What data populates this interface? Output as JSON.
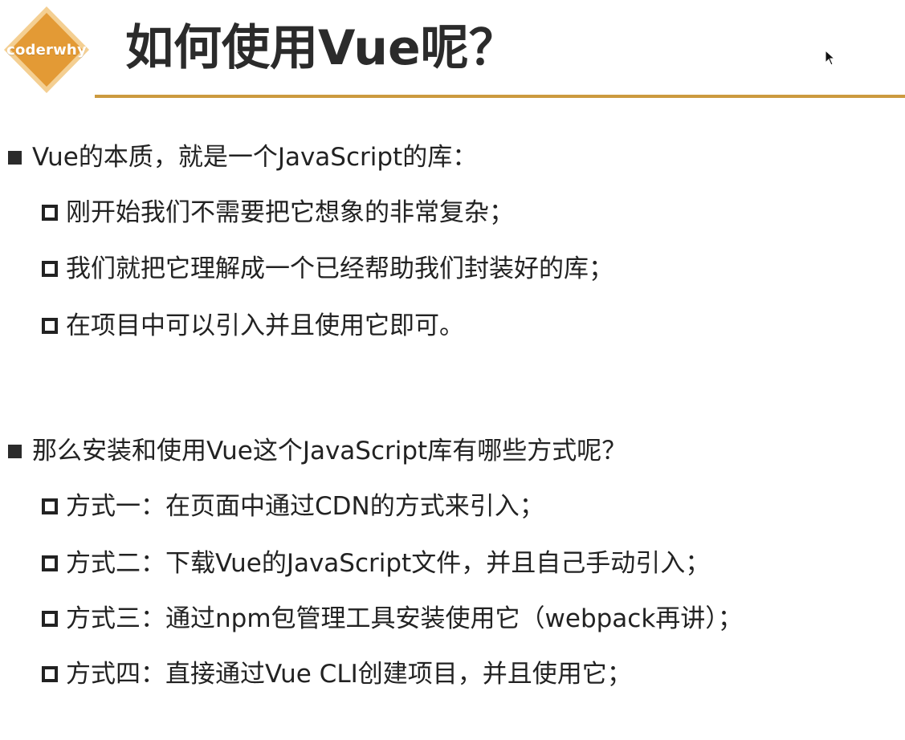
{
  "logo": {
    "text": "coderwhy",
    "colors": {
      "fill": "#e39a35",
      "border": "#f4cf92"
    }
  },
  "header": {
    "title": "如何使用Vue呢？",
    "rule_color": "#cc9a3f"
  },
  "sections": [
    {
      "heading": "Vue的本质，就是一个JavaScript的库：",
      "items": [
        "刚开始我们不需要把它想象的非常复杂；",
        "我们就把它理解成一个已经帮助我们封装好的库；",
        "在项目中可以引入并且使用它即可。"
      ]
    },
    {
      "heading": "那么安装和使用Vue这个JavaScript库有哪些方式呢？",
      "items": [
        "方式一：在页面中通过CDN的方式来引入；",
        "方式二：下载Vue的JavaScript文件，并且自己手动引入；",
        "方式三：通过npm包管理工具安装使用它（webpack再讲）；",
        "方式四：直接通过Vue CLI创建项目，并且使用它；"
      ]
    }
  ],
  "icons": {
    "cursor": "mouse-pointer-icon",
    "filled_bullet": "filled-square-bullet-icon",
    "hollow_bullet": "hollow-square-bullet-icon"
  }
}
